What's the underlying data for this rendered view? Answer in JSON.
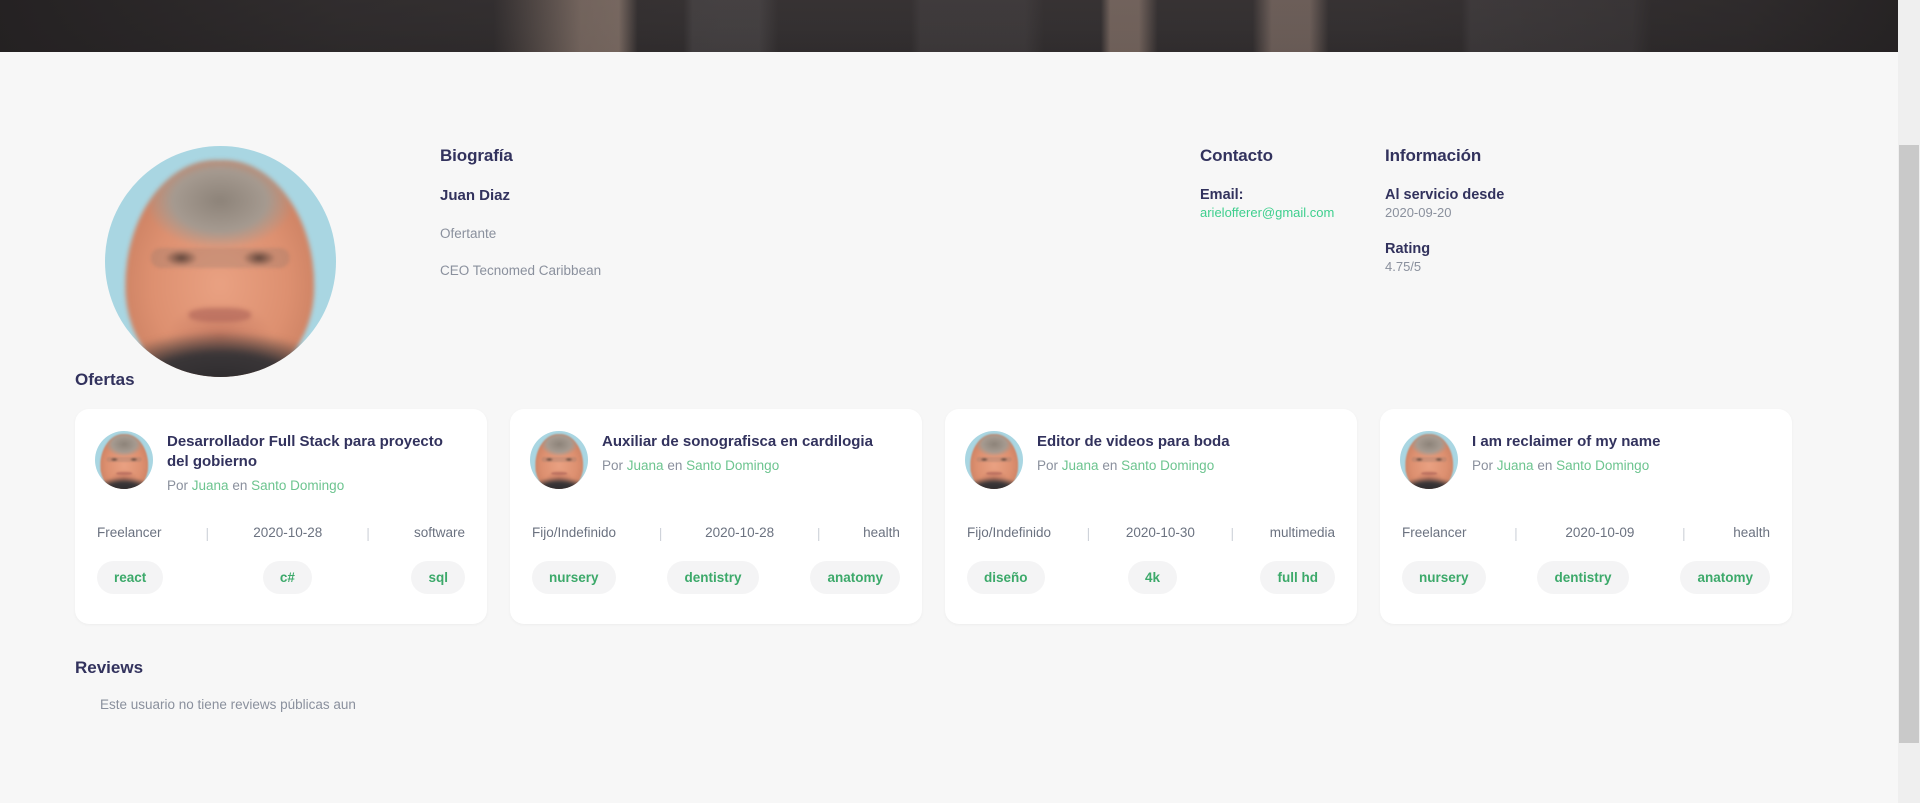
{
  "profile": {
    "avatar_alt": "user-avatar-photo",
    "cover_alt": "profile-cover-photo"
  },
  "bio": {
    "heading": "Biografía",
    "name": "Juan Diaz",
    "role": "Ofertante",
    "description": "CEO Tecnomed Caribbean"
  },
  "contact": {
    "heading": "Contacto",
    "email_label": "Email:",
    "email_value": "arielofferer@gmail.com"
  },
  "information": {
    "heading": "Información",
    "since_label": "Al servicio desde",
    "since_value": "2020-09-20",
    "rating_label": "Rating",
    "rating_value": "4.75/5"
  },
  "offers": {
    "heading": "Ofertas",
    "by_prefix": "Por",
    "in_word": "en",
    "separator": "|",
    "items": [
      {
        "title": "Desarrollador Full Stack para proyecto del gobierno",
        "author": "Juana",
        "location": "Santo Domingo",
        "contract": "Freelancer",
        "date": "2020-10-28",
        "category": "software",
        "tags": [
          "react",
          "c#",
          "sql"
        ]
      },
      {
        "title": "Auxiliar de sonografisca en cardilogia",
        "author": "Juana",
        "location": "Santo Domingo",
        "contract": "Fijo/Indefinido",
        "date": "2020-10-28",
        "category": "health",
        "tags": [
          "nursery",
          "dentistry",
          "anatomy"
        ]
      },
      {
        "title": "Editor de videos para boda",
        "author": "Juana",
        "location": "Santo Domingo",
        "contract": "Fijo/Indefinido",
        "date": "2020-10-30",
        "category": "multimedia",
        "tags": [
          "diseño",
          "4k",
          "full hd"
        ]
      },
      {
        "title": "I am reclaimer of my name",
        "author": "Juana",
        "location": "Santo Domingo",
        "contract": "Freelancer",
        "date": "2020-10-09",
        "category": "health",
        "tags": [
          "nursery",
          "dentistry",
          "anatomy"
        ]
      }
    ]
  },
  "reviews": {
    "heading": "Reviews",
    "empty_message": "Este usuario no tiene reviews públicas aun"
  },
  "colors": {
    "accent_green": "#3ecf8e",
    "link_green": "#6cc48f",
    "tag_green": "#3ca96a",
    "heading": "#32325d",
    "muted": "#8a909d",
    "page_bg": "#f7f7f7",
    "card_bg": "#ffffff",
    "cover_bg": "#332f2f"
  }
}
